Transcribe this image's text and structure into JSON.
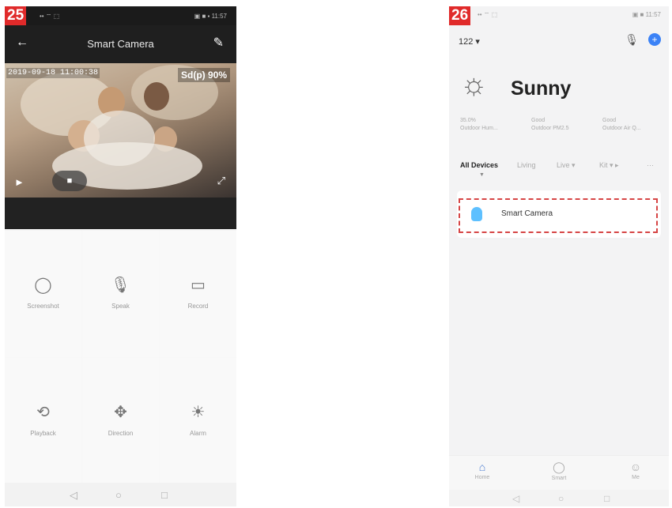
{
  "screen_left": {
    "step_number": "25",
    "status_left": "•• ⌔ ⬚",
    "status_right": "▣ ■ ▪ 11:57",
    "appbar": {
      "back_icon": "arrow-left-icon",
      "title": "Smart Camera",
      "edit_icon": "pencil-icon"
    },
    "video": {
      "timestamp": "2019-09-18 11:00:38",
      "quality": "Sd(p) 90%"
    },
    "controls": [
      {
        "icon": "camera-icon",
        "label": "Screenshot",
        "glyph": "📷"
      },
      {
        "icon": "microphone-icon",
        "label": "Speak",
        "glyph": "🎙"
      },
      {
        "icon": "record-icon",
        "label": "Record",
        "glyph": "▭"
      },
      {
        "icon": "playback-icon",
        "label": "Playback",
        "glyph": "⟲"
      },
      {
        "icon": "direction-icon",
        "label": "Direction",
        "glyph": "✥"
      },
      {
        "icon": "alarm-icon",
        "label": "Alarm",
        "glyph": "🔔"
      }
    ],
    "nav": {
      "back": "◁",
      "home": "○",
      "recent": "□"
    }
  },
  "screen_right": {
    "step_number": "26",
    "status_left": "•• ⌔ ⬚",
    "status_right": "▣ ■ 11:57",
    "home_name": "122 ▾",
    "weather": "Sunny",
    "stats": [
      {
        "value": "35.0%",
        "label": "Outdoor Hum..."
      },
      {
        "value": "Good",
        "label": "Outdoor PM2.5"
      },
      {
        "value": "Good",
        "label": "Outdoor Air Q..."
      }
    ],
    "tabs": [
      "All Devices",
      "Living",
      "Live ▾",
      "Kit ▾ ▸",
      "···"
    ],
    "device_name": "Smart Camera",
    "bottom_tabs": [
      {
        "icon": "home-icon",
        "label": "Home",
        "glyph": "⌂"
      },
      {
        "icon": "smart-icon",
        "label": "Smart",
        "glyph": "○"
      },
      {
        "icon": "me-icon",
        "label": "Me",
        "glyph": "☺"
      }
    ],
    "nav": {
      "back": "◁",
      "home": "○",
      "recent": "□"
    }
  }
}
